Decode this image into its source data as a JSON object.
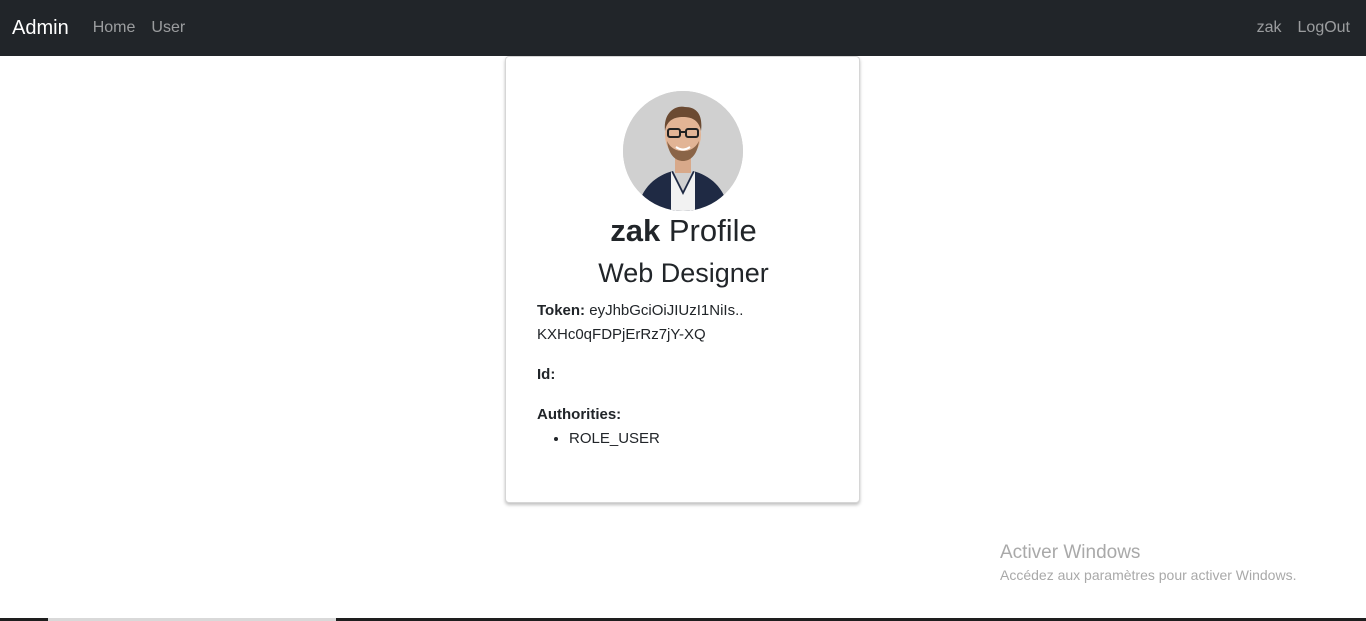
{
  "navbar": {
    "brand": "Admin",
    "links": [
      "Home",
      "User"
    ],
    "right": {
      "username": "zak",
      "logout": "LogOut"
    }
  },
  "profile": {
    "avatar_icon": "avatar-photo",
    "username": "zak",
    "title_suffix": "Profile",
    "role_title": "Web Designer",
    "token_label": "Token:",
    "token_line1": "eyJhbGciOiJIUzI1NiIs..",
    "token_line2": "KXHc0qFDPjErRz7jY-XQ",
    "id_label": "Id:",
    "id_value": "",
    "authorities_label": "Authorities:",
    "authorities": [
      "ROLE_USER"
    ]
  },
  "watermark": {
    "title": "Activer Windows",
    "subtitle": "Accédez aux paramètres pour activer Windows."
  }
}
